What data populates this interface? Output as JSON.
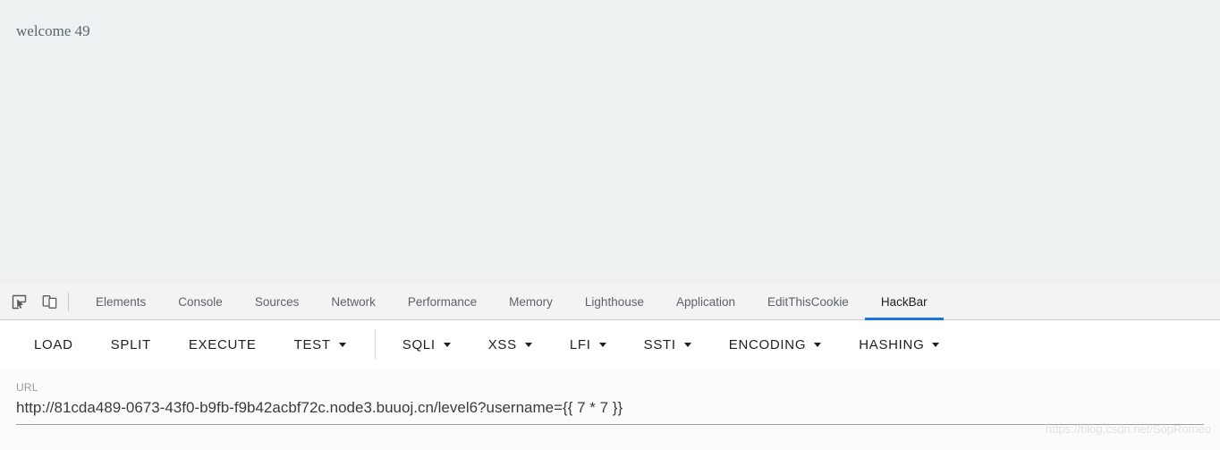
{
  "colors": {
    "accent": "#1a73e8",
    "page_background": "#eef1f2",
    "tabbar_background": "#f3f3f3",
    "panel_background": "#ffffff",
    "url_area_background": "#fbfbfb"
  },
  "page": {
    "body_text": "welcome 49"
  },
  "devtools": {
    "icons": [
      {
        "name": "inspect-element-icon",
        "label": "Inspect element"
      },
      {
        "name": "device-toolbar-icon",
        "label": "Toggle device toolbar"
      }
    ],
    "tabs": [
      {
        "label": "Elements",
        "active": false
      },
      {
        "label": "Console",
        "active": false
      },
      {
        "label": "Sources",
        "active": false
      },
      {
        "label": "Network",
        "active": false
      },
      {
        "label": "Performance",
        "active": false
      },
      {
        "label": "Memory",
        "active": false
      },
      {
        "label": "Lighthouse",
        "active": false
      },
      {
        "label": "Application",
        "active": false
      },
      {
        "label": "EditThisCookie",
        "active": false
      },
      {
        "label": "HackBar",
        "active": true
      }
    ]
  },
  "hackbar": {
    "buttons": [
      {
        "label": "LOAD",
        "dropdown": false
      },
      {
        "label": "SPLIT",
        "dropdown": false
      },
      {
        "label": "EXECUTE",
        "dropdown": false
      },
      {
        "label": "TEST",
        "dropdown": true
      },
      {
        "label": "SQLI",
        "dropdown": true
      },
      {
        "label": "XSS",
        "dropdown": true
      },
      {
        "label": "LFI",
        "dropdown": true
      },
      {
        "label": "SSTI",
        "dropdown": true
      },
      {
        "label": "ENCODING",
        "dropdown": true
      },
      {
        "label": "HASHING",
        "dropdown": true
      }
    ],
    "divider_after_index": 3,
    "url": {
      "label": "URL",
      "value": "http://81cda489-0673-43f0-b9fb-f9b42acbf72c.node3.buuoj.cn/level6?username={{ 7 * 7 }}",
      "placeholder": "URL"
    }
  },
  "watermark": {
    "text": "https://blog.csdn.net/SopRomeo"
  }
}
